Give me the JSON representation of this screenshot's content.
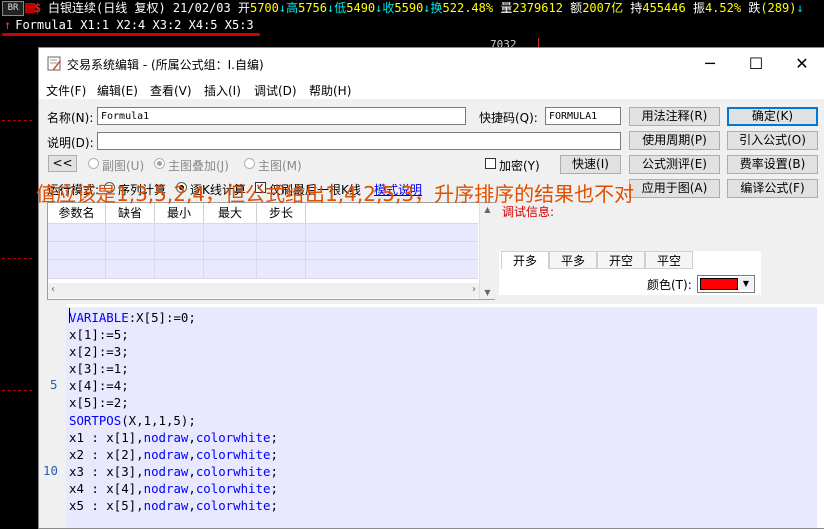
{
  "ticker": {
    "br": "BR",
    "symbol": "白银连续(日线 复权)",
    "date": "21/02/03",
    "open_label": "开",
    "open": "5700",
    "high_label": "↓高",
    "high": "5756",
    "low_label": "↓低",
    "low": "5490",
    "close_label": "↓收",
    "close": "5590",
    "turnover_label": "↓换",
    "turnover": "522.48%",
    "volume_label": "量",
    "volume": "2379612",
    "amount_label": "额",
    "amount": "2007亿",
    "hold_label": "持",
    "hold": "455446",
    "amp_label": "振",
    "amp": "4.52%",
    "fall_label": "跌",
    "fall": "(289)",
    "fall_tail": "↓"
  },
  "formula_line": "Formula1 X1:1 X2:4 X3:2 X4:5 X5:3",
  "chart_number": "7032",
  "dialog": {
    "title": "交易系统编辑 - (所属公式组：I.自编)",
    "menu": [
      "文件(F)",
      "编辑(E)",
      "查看(V)",
      "插入(I)",
      "调试(D)",
      "帮助(H)"
    ],
    "name_label": "名称(N):",
    "name_value": "Formula1",
    "shortcut_label": "快捷码(Q):",
    "shortcut_value": "FORMULA1",
    "desc_label": "说明(D):",
    "desc_value": "",
    "collapse_btn": "<<",
    "radio_subchart": "副图(U)",
    "radio_overlay": "主图叠加(J)",
    "radio_main": "主图(M)",
    "encrypt_label": "加密(Y)",
    "speed_btn": "快速(I)",
    "run_mode_label": "运行模式:",
    "run_seq": "序列计算",
    "run_kline": "逐K线计算",
    "last_bar_only": "仅刷最后一根K线",
    "mode_help": "模式说明",
    "buttons_right": {
      "usage_note": "用法注释(R)",
      "use_period": "使用周期(P)",
      "formula_test": "公式测评(E)",
      "apply_chart": "应用于图(A)",
      "ok": "确定(K)",
      "import": "引入公式(O)",
      "fee": "费率设置(B)",
      "compile": "编译公式(F)"
    },
    "param_headers": [
      "参数名",
      "缺省",
      "最小",
      "最大",
      "步长"
    ],
    "debug_label": "调试信息:",
    "signal_tabs": [
      "开多",
      "平多",
      "开空",
      "平空"
    ],
    "color_label": "颜色(T):",
    "color_value": "#ff0000"
  },
  "annotation": "值应该是1,3,5,2,4，但公式给出1,4,2,5,3，升序排序的结果也不对",
  "editor": {
    "line_numbers": [
      {
        "n": "5",
        "row": 4
      },
      {
        "n": "10",
        "row": 9
      }
    ],
    "lines": [
      [
        {
          "t": "VARIABLE",
          "k": 1
        },
        {
          "t": ":X[5]:=0;",
          "k": 0
        }
      ],
      [
        {
          "t": "x[1]:=5;",
          "k": 0
        }
      ],
      [
        {
          "t": "x[2]:=3;",
          "k": 0
        }
      ],
      [
        {
          "t": "x[3]:=1;",
          "k": 0
        }
      ],
      [
        {
          "t": "x[4]:=4;",
          "k": 0
        }
      ],
      [
        {
          "t": "x[5]:=2;",
          "k": 0
        }
      ],
      [
        {
          "t": "SORTPOS",
          "k": 1
        },
        {
          "t": "(X,1,1,5);",
          "k": 0
        }
      ],
      [
        {
          "t": "x1 : x[1],",
          "k": 0
        },
        {
          "t": "nodraw",
          "k": 1
        },
        {
          "t": ",",
          "k": 0
        },
        {
          "t": "colorwhite",
          "k": 1
        },
        {
          "t": ";",
          "k": 0
        }
      ],
      [
        {
          "t": "x2 : x[2],",
          "k": 0
        },
        {
          "t": "nodraw",
          "k": 1
        },
        {
          "t": ",",
          "k": 0
        },
        {
          "t": "colorwhite",
          "k": 1
        },
        {
          "t": ";",
          "k": 0
        }
      ],
      [
        {
          "t": "x3 : x[3],",
          "k": 0
        },
        {
          "t": "nodraw",
          "k": 1
        },
        {
          "t": ",",
          "k": 0
        },
        {
          "t": "colorwhite",
          "k": 1
        },
        {
          "t": ";",
          "k": 0
        }
      ],
      [
        {
          "t": "x4 : x[4],",
          "k": 0
        },
        {
          "t": "nodraw",
          "k": 1
        },
        {
          "t": ",",
          "k": 0
        },
        {
          "t": "colorwhite",
          "k": 1
        },
        {
          "t": ";",
          "k": 0
        }
      ],
      [
        {
          "t": "x5 : x[5],",
          "k": 0
        },
        {
          "t": "nodraw",
          "k": 1
        },
        {
          "t": ",",
          "k": 0
        },
        {
          "t": "colorwhite",
          "k": 1
        },
        {
          "t": ";",
          "k": 0
        }
      ]
    ]
  }
}
